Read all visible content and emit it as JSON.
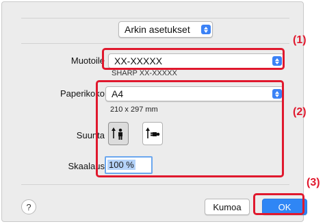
{
  "toolbar": {
    "menu_label": "Arkin asetukset"
  },
  "format": {
    "label": "Muotoile",
    "value": "XX-XXXXX",
    "caption": "SHARP XX-XXXXX"
  },
  "paper": {
    "label": "Paperikoko",
    "value": "A4",
    "dimensions": "210 x 297 mm"
  },
  "orientation": {
    "label": "Suunta",
    "selected": "portrait"
  },
  "scale": {
    "label": "Skaalaus",
    "value": "100 %"
  },
  "buttons": {
    "help": "?",
    "cancel": "Kumoa",
    "ok": "OK"
  },
  "markers": {
    "one": "(1)",
    "two": "(2)",
    "three": "(3)"
  },
  "colors": {
    "highlight": "#e0182d",
    "accent": "#2f86f5"
  }
}
